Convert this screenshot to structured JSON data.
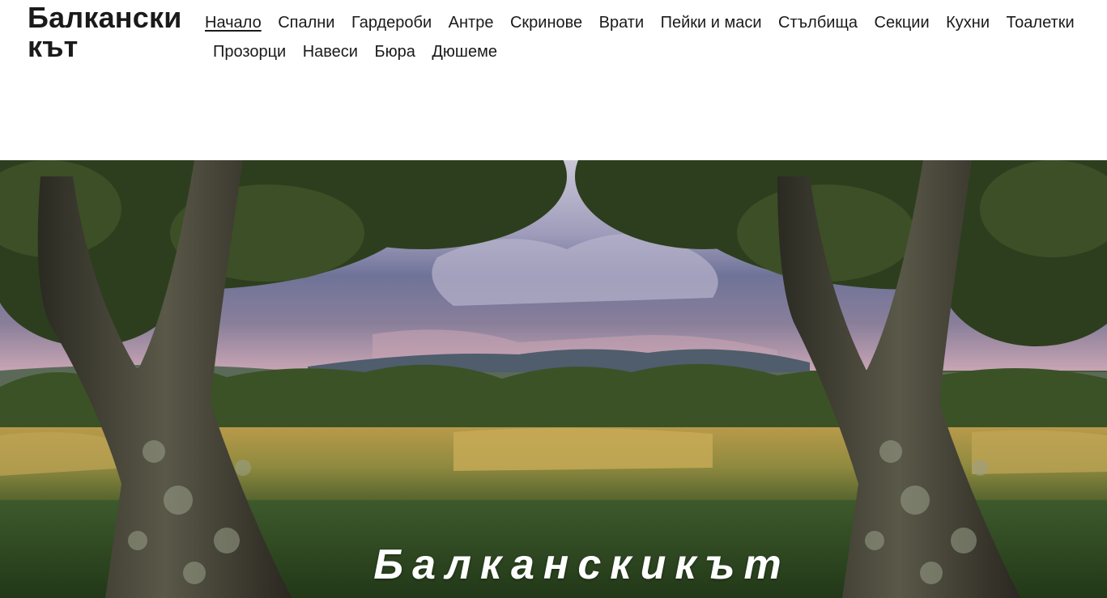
{
  "site": {
    "logo": "Балкански кът"
  },
  "nav": {
    "items": [
      {
        "label": "Начало",
        "active": true
      },
      {
        "label": "Спални"
      },
      {
        "label": "Гардероби"
      },
      {
        "label": "Антре"
      },
      {
        "label": "Скринове"
      },
      {
        "label": "Врати"
      },
      {
        "label": "Пейки и маси"
      },
      {
        "label": "Стълбища"
      },
      {
        "label": "Секции"
      },
      {
        "label": "Кухни"
      },
      {
        "label": "Тоалетки"
      },
      {
        "label": "Прозорци"
      },
      {
        "label": "Навеси"
      },
      {
        "label": "Бюра"
      },
      {
        "label": "Дюшеме"
      }
    ]
  },
  "hero": {
    "title": "Балканскикът",
    "image": "landscape-with-trees"
  },
  "colors": {
    "text": "#1a1a1a",
    "background": "#ffffff",
    "hero_title": "#ffffff"
  }
}
